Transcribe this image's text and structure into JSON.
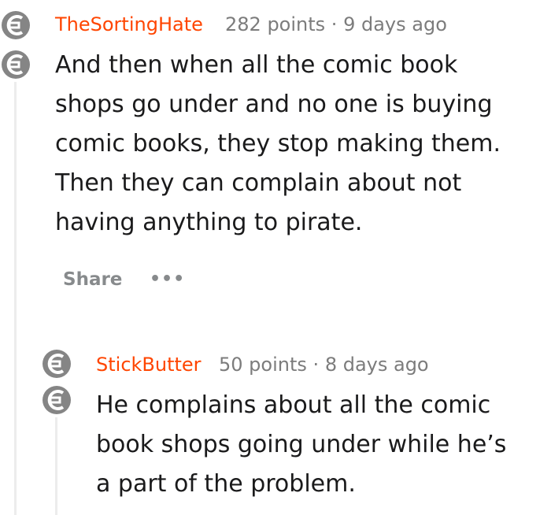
{
  "colors": {
    "accent": "#ff4500",
    "meta": "#7c7c7c",
    "text": "#1a1a1b",
    "thread_line": "#ececec",
    "icon": "#858585"
  },
  "comments": [
    {
      "author": "TheSortingHate",
      "points": "282 points",
      "separator": "·",
      "age": "9 days ago",
      "lines": [
        "And then when all the comic book",
        "shops go under and no one is buying",
        "comic books, they stop making them.",
        "Then they can complain about not",
        "having anything to pirate."
      ],
      "share_label": "Share",
      "more_label": "•••"
    },
    {
      "author": "StickButter",
      "points": "50 points",
      "separator": "·",
      "age": "8 days ago",
      "lines": [
        "He complains about all the comic",
        "book shops going under while he’s",
        "a part of the problem."
      ]
    }
  ]
}
